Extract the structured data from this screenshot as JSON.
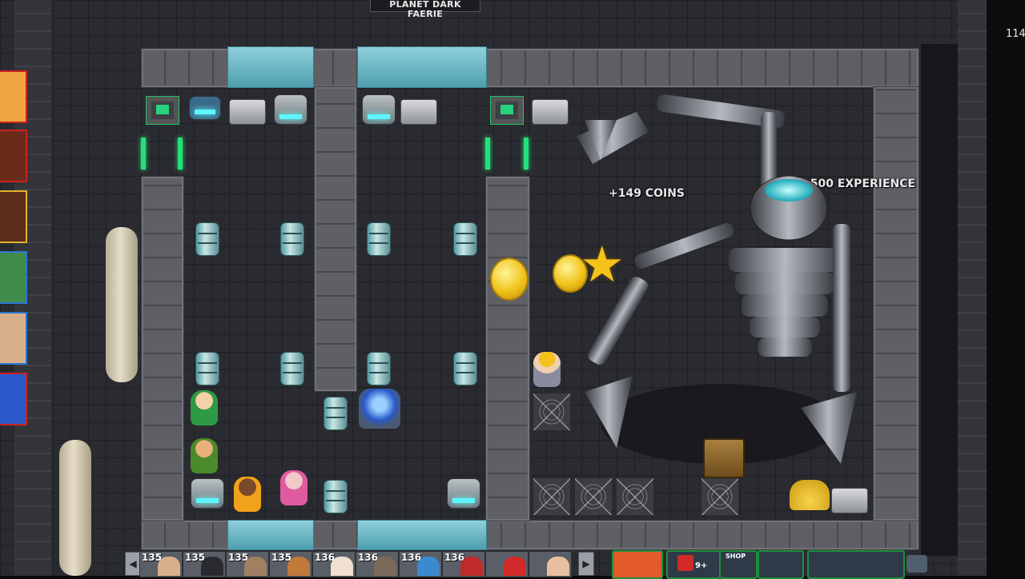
{
  "location": {
    "title": "PLANET DARK FAERIE"
  },
  "edge_number": "114",
  "popups": {
    "coins": "+149 COINS",
    "experience": "+500 EXPERIENCE"
  },
  "toolbar": {
    "prev": "◀",
    "next": "▶",
    "friend_slots": [
      {
        "level": "135"
      },
      {
        "level": "135"
      },
      {
        "level": "135"
      },
      {
        "level": "135"
      },
      {
        "level": "136"
      },
      {
        "level": "136"
      },
      {
        "level": "136"
      },
      {
        "level": "136"
      },
      {
        "level": ""
      }
    ],
    "gift_badge": "9+",
    "shop_label": "SHOP"
  },
  "colors": {
    "accent_teal": "#5ff5ff",
    "terminal_green": "#27d27a",
    "coin_gold": "#f1c21a",
    "tab_red": "#cc2222"
  }
}
